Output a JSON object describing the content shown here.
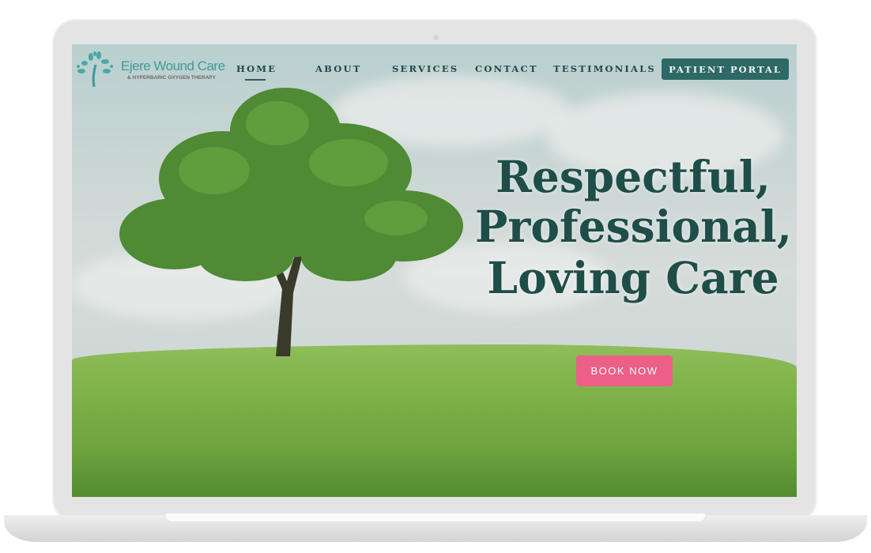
{
  "site": {
    "logo_title": "Ejere Wound Care",
    "logo_subtitle": "& HYPERBARIC OXYGEN THERAPY"
  },
  "nav": {
    "items": [
      {
        "label": "HOME",
        "active": true
      },
      {
        "label": "ABOUT"
      },
      {
        "label": "SERVICES"
      },
      {
        "label": "CONTACT"
      },
      {
        "label": "TESTIMONIALS"
      }
    ],
    "portal_label": "PATIENT PORTAL"
  },
  "hero": {
    "lines": [
      "Respectful,",
      "Professional,",
      "Loving Care"
    ],
    "cta_label": "BOOK NOW"
  },
  "colors": {
    "brand_teal": "#2d6966",
    "heading": "#1f4d48",
    "cta_pink": "#ec5f87",
    "logo_teal": "#3f9a9a"
  }
}
